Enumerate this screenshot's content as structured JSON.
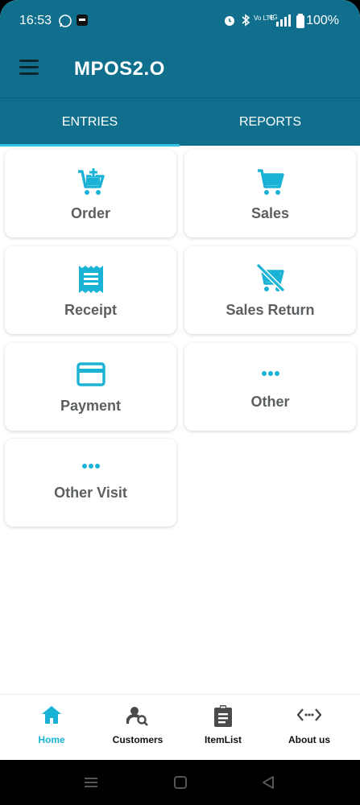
{
  "status": {
    "time": "16:53",
    "battery": "100%",
    "network": "4G",
    "volte": "Vo LTE"
  },
  "app": {
    "title": "MPOS2.O"
  },
  "tabs": [
    {
      "label": "ENTRIES",
      "selected": true
    },
    {
      "label": "REPORTS",
      "selected": false
    }
  ],
  "tiles": [
    {
      "label": "Order",
      "icon": "cart-plus-icon"
    },
    {
      "label": "Sales",
      "icon": "cart-icon"
    },
    {
      "label": "Receipt",
      "icon": "receipt-icon"
    },
    {
      "label": "Sales Return",
      "icon": "cart-off-icon"
    },
    {
      "label": "Payment",
      "icon": "credit-card-icon"
    },
    {
      "label": "Other",
      "icon": "more-horizontal-icon"
    },
    {
      "label": "Other Visit",
      "icon": "more-horizontal-icon"
    }
  ],
  "bottom_nav": [
    {
      "label": "Home",
      "icon": "home-icon",
      "selected": true
    },
    {
      "label": "Customers",
      "icon": "customer-search-icon",
      "selected": false
    },
    {
      "label": "ItemList",
      "icon": "clipboard-list-icon",
      "selected": false
    },
    {
      "label": "About us",
      "icon": "code-dots-icon",
      "selected": false
    }
  ],
  "colors": {
    "primary": "#0f6f8c",
    "accent": "#1ab3d6",
    "tab_indicator": "#2ec4e6",
    "tile_label": "#5c5f61"
  }
}
